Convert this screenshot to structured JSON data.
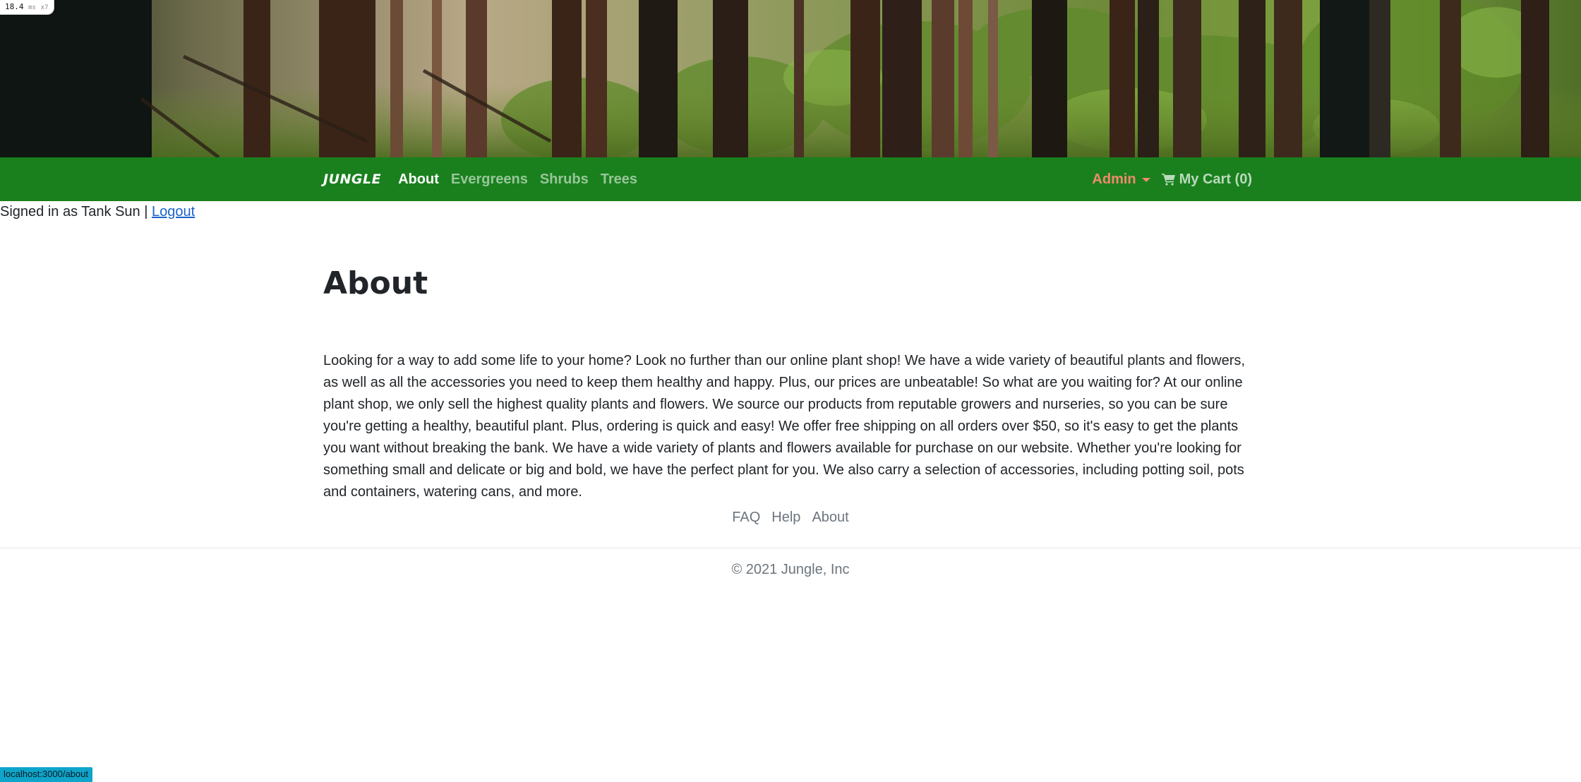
{
  "perf": {
    "value": "18.4",
    "unit": "ms",
    "multiplier": "x7"
  },
  "nav": {
    "brand": "JUNGLE",
    "links": [
      {
        "label": "About",
        "active": true
      },
      {
        "label": "Evergreens",
        "active": false
      },
      {
        "label": "Shrubs",
        "active": false
      },
      {
        "label": "Trees",
        "active": false
      }
    ],
    "admin_label": "Admin",
    "cart_label": "My Cart (0)"
  },
  "session": {
    "signed_in_text": "Signed in as Tank Sun |",
    "logout_label": "Logout"
  },
  "main": {
    "title": "About",
    "body": "Looking for a way to add some life to your home? Look no further than our online plant shop! We have a wide variety of beautiful plants and flowers, as well as all the accessories you need to keep them healthy and happy. Plus, our prices are unbeatable! So what are you waiting for? At our online plant shop, we only sell the highest quality plants and flowers. We source our products from reputable growers and nurseries, so you can be sure you're getting a healthy, beautiful plant. Plus, ordering is quick and easy! We offer free shipping on all orders over $50, so it's easy to get the plants you want without breaking the bank. We have a wide variety of plants and flowers available for purchase on our website. Whether you're looking for something small and delicate or big and bold, we have the perfect plant for you. We also carry a selection of accessories, including potting soil, pots and containers, watering cans, and more."
  },
  "footer": {
    "links": [
      "FAQ",
      "Help",
      "About"
    ],
    "copyright": "© 2021 Jungle, Inc"
  },
  "status_bar": {
    "url": "localhost:3000/about"
  },
  "colors": {
    "navbar": "#19801d",
    "admin": "#f08a6c",
    "link": "#1a63c9",
    "status": "#0fa4c9"
  },
  "icons": [
    "cart-icon",
    "caret-down-icon"
  ]
}
